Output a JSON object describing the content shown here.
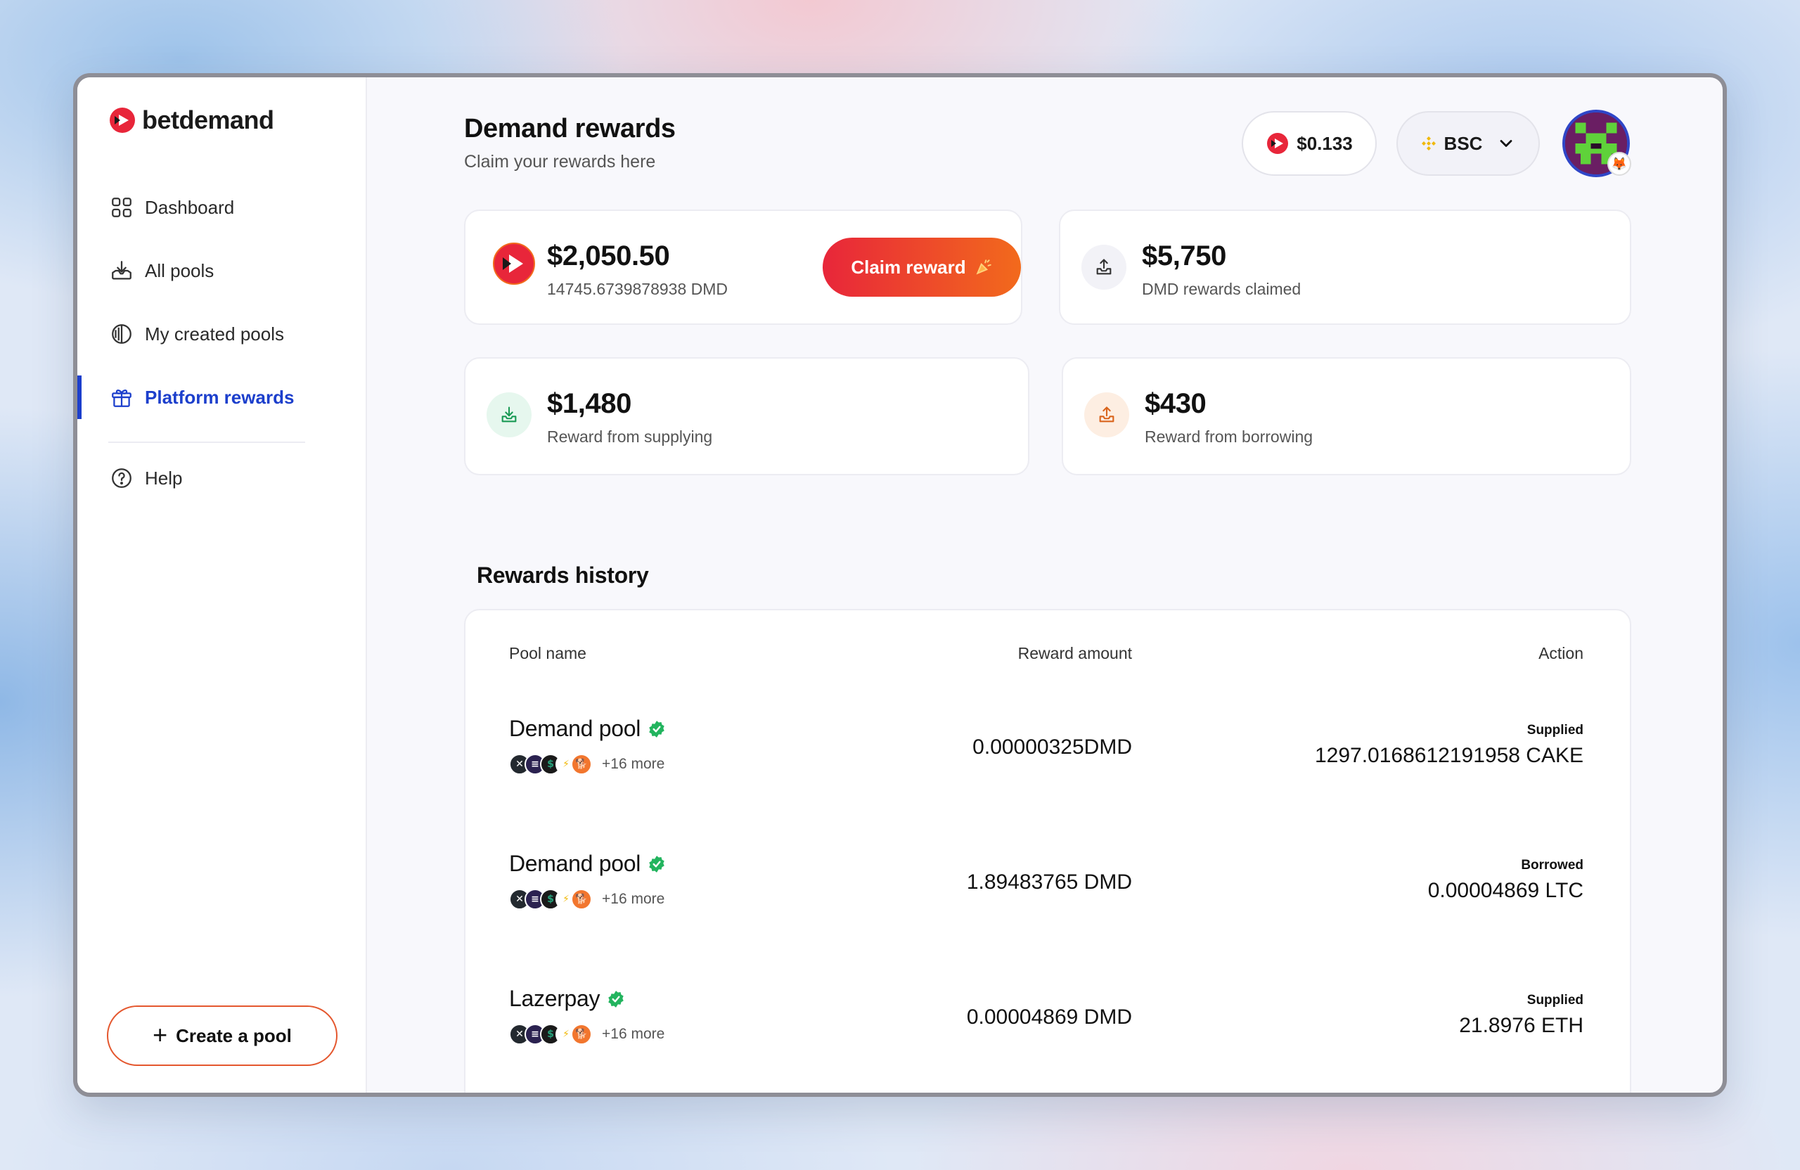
{
  "brand": {
    "name": "betdemand",
    "color": "#e8263a"
  },
  "sidebar": {
    "items": [
      {
        "label": "Dashboard",
        "icon": "grid-icon"
      },
      {
        "label": "All pools",
        "icon": "download-tray-icon"
      },
      {
        "label": "My created pools",
        "icon": "half-circle-icon"
      },
      {
        "label": "Platform rewards",
        "icon": "gift-icon",
        "active": true
      },
      {
        "label": "Help",
        "icon": "help-circle-icon"
      }
    ],
    "create_label": "Create a pool"
  },
  "header": {
    "title": "Demand rewards",
    "subtitle": "Claim your rewards here",
    "price": "$0.133",
    "chain": "BSC"
  },
  "cards": {
    "main": {
      "amount": "$2,050.50",
      "label": "14745.6739878938 DMD",
      "button": "Claim reward"
    },
    "claimed": {
      "amount": "$5,750",
      "label": "DMD rewards claimed"
    },
    "supplying": {
      "amount": "$1,480",
      "label": "Reward from supplying"
    },
    "borrowing": {
      "amount": "$430",
      "label": "Reward from borrowing"
    }
  },
  "history": {
    "title": "Rewards history",
    "columns": [
      "Pool name",
      "Reward amount",
      "Action"
    ],
    "rows": [
      {
        "pool": "Demand pool",
        "more": "+16 more",
        "reward": "0.00000325DMD",
        "action": "Supplied",
        "value": "1297.0168612191958 CAKE"
      },
      {
        "pool": "Demand pool",
        "more": "+16 more",
        "reward": "1.89483765 DMD",
        "action": "Borrowed",
        "value": "0.00004869 LTC"
      },
      {
        "pool": "Lazerpay",
        "more": "+16 more",
        "reward": "0.00004869 DMD",
        "action": "Supplied",
        "value": "21.8976 ETH"
      }
    ]
  },
  "colors": {
    "accent": "#1c3fcc",
    "verified": "#22b45e",
    "supply_tint": "#e6f7ee",
    "borrow_tint": "#fdeee2"
  }
}
